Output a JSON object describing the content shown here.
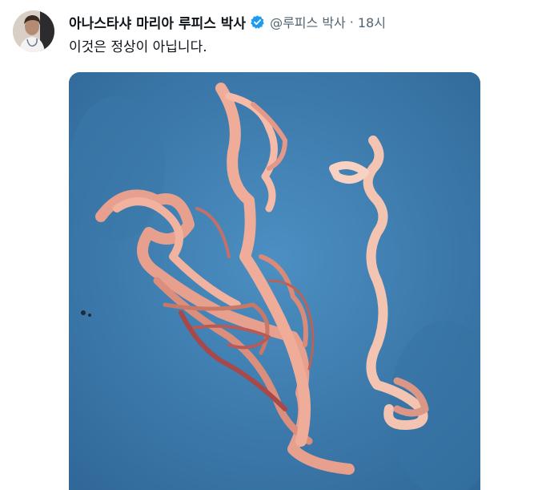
{
  "tweet": {
    "author": {
      "display_name": "아나스타샤 마리아 루피스 박사",
      "handle": "@루피스 박사",
      "avatar_icon": "doctor-avatar-photo",
      "verified_icon": "verified-badge-icon",
      "verified_color": "#1d9bf0"
    },
    "separator": "·",
    "time": "18시",
    "text": "이것은 정상이 아닙니다.",
    "media": {
      "icon": "photo-of-rubbery-clots-on-blue-tray",
      "background_color": "#3f7fb0"
    }
  }
}
